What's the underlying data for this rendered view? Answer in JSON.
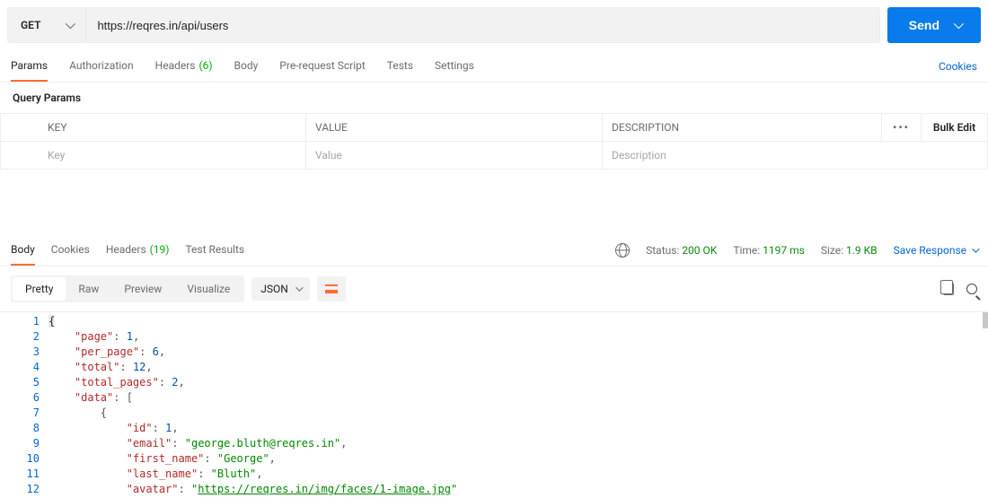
{
  "request": {
    "method": "GET",
    "url": "https://reqres.in/api/users",
    "send_label": "Send"
  },
  "tabs": {
    "params": "Params",
    "authorization": "Authorization",
    "headers_label": "Headers",
    "headers_count": "(6)",
    "body": "Body",
    "prerequest": "Pre-request Script",
    "tests": "Tests",
    "settings": "Settings",
    "cookies": "Cookies"
  },
  "params_section": {
    "title": "Query Params",
    "col_key": "KEY",
    "col_value": "VALUE",
    "col_desc": "DESCRIPTION",
    "more": "•••",
    "bulk_edit": "Bulk Edit",
    "ph_key": "Key",
    "ph_value": "Value",
    "ph_desc": "Description"
  },
  "response_tabs": {
    "body": "Body",
    "cookies": "Cookies",
    "headers_label": "Headers",
    "headers_count": "(19)",
    "test_results": "Test Results"
  },
  "response_meta": {
    "status_label": "Status:",
    "status_value": "200 OK",
    "time_label": "Time:",
    "time_value": "1197 ms",
    "size_label": "Size:",
    "size_value": "1.9 KB",
    "save_response": "Save Response"
  },
  "formatter": {
    "pretty": "Pretty",
    "raw": "Raw",
    "preview": "Preview",
    "visualize": "Visualize",
    "language": "JSON"
  },
  "code": {
    "json": {
      "page": 1,
      "per_page": 6,
      "total": 12,
      "total_pages": 2,
      "data_first": {
        "id": 1,
        "email": "george.bluth@reqres.in",
        "first_name": "George",
        "last_name": "Bluth",
        "avatar": "https://reqres.in/img/faces/1-image.jpg"
      }
    }
  }
}
